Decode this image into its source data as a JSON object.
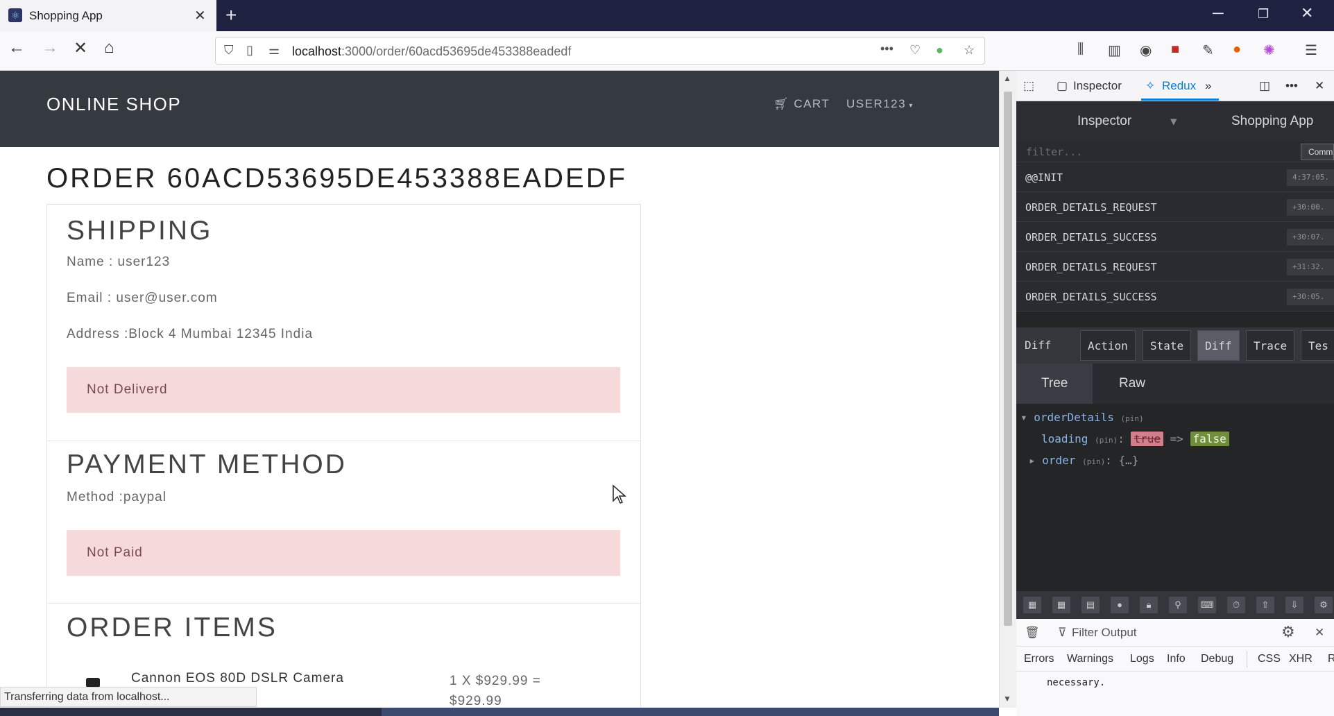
{
  "browser": {
    "tab_title": "Shopping App",
    "tab_close": "✕",
    "new_tab": "+",
    "url_host": "localhost",
    "url_path": ":3000/order/60acd53695de453388eadedf",
    "page_actions": "•••",
    "status": "Transferring data from localhost..."
  },
  "site": {
    "brand": "ONLINE SHOP",
    "cart_label": "CART",
    "user_label": "USER123"
  },
  "order": {
    "title": "ORDER 60ACD53695DE453388EADEDF",
    "shipping": {
      "heading": "SHIPPING",
      "name_line": "Name : user123",
      "email_line": "Email : user@user.com",
      "address_line": "Address :Block 4 Mumbai 12345 India",
      "delivery_status": "Not Deliverd"
    },
    "payment": {
      "heading": "PAYMENT METHOD",
      "method_line": "Method :paypal",
      "paid_status": "Not Paid"
    },
    "items": {
      "heading": "ORDER ITEMS",
      "list": [
        {
          "name": "Cannon EOS 80D DSLR Camera",
          "price": "1 X $929.99 = $929.99"
        }
      ]
    }
  },
  "devtools": {
    "inspector_tab": "Inspector",
    "redux_tab": "Redux",
    "redux": {
      "monitor": "Inspector",
      "instance": "Shopping App",
      "filter_placeholder": "filter...",
      "commit_label": "Comm",
      "actions": [
        {
          "name": "@@INIT",
          "time": "4:37:05."
        },
        {
          "name": "ORDER_DETAILS_REQUEST",
          "time": "+30:00."
        },
        {
          "name": "ORDER_DETAILS_SUCCESS",
          "time": "+30:07."
        },
        {
          "name": "ORDER_DETAILS_REQUEST",
          "time": "+31:32."
        },
        {
          "name": "ORDER_DETAILS_SUCCESS",
          "time": "+30:05."
        }
      ],
      "section_label": "Diff",
      "tabs": [
        "Action",
        "State",
        "Diff",
        "Trace",
        "Tes"
      ],
      "active_tab": "Diff",
      "view_tabs": [
        "Tree",
        "Raw"
      ],
      "active_view": "Tree",
      "tree": {
        "root_key": "orderDetails",
        "pin": "(pin)",
        "loading_key": "loading",
        "loading_old": "true",
        "arrow": "=>",
        "loading_new": "false",
        "order_key": "order",
        "order_value": "{…}"
      }
    },
    "console": {
      "filter_placeholder": "Filter Output",
      "filters": [
        "Errors",
        "Warnings",
        "Logs",
        "Info",
        "Debug",
        "CSS",
        "XHR",
        "R"
      ],
      "message": "necessary."
    }
  },
  "colors": {
    "header_bg": "#343a40",
    "alert_bg": "#f6d9da",
    "devtools_bg": "#232526",
    "redux_accent": "#0a7bd6"
  }
}
